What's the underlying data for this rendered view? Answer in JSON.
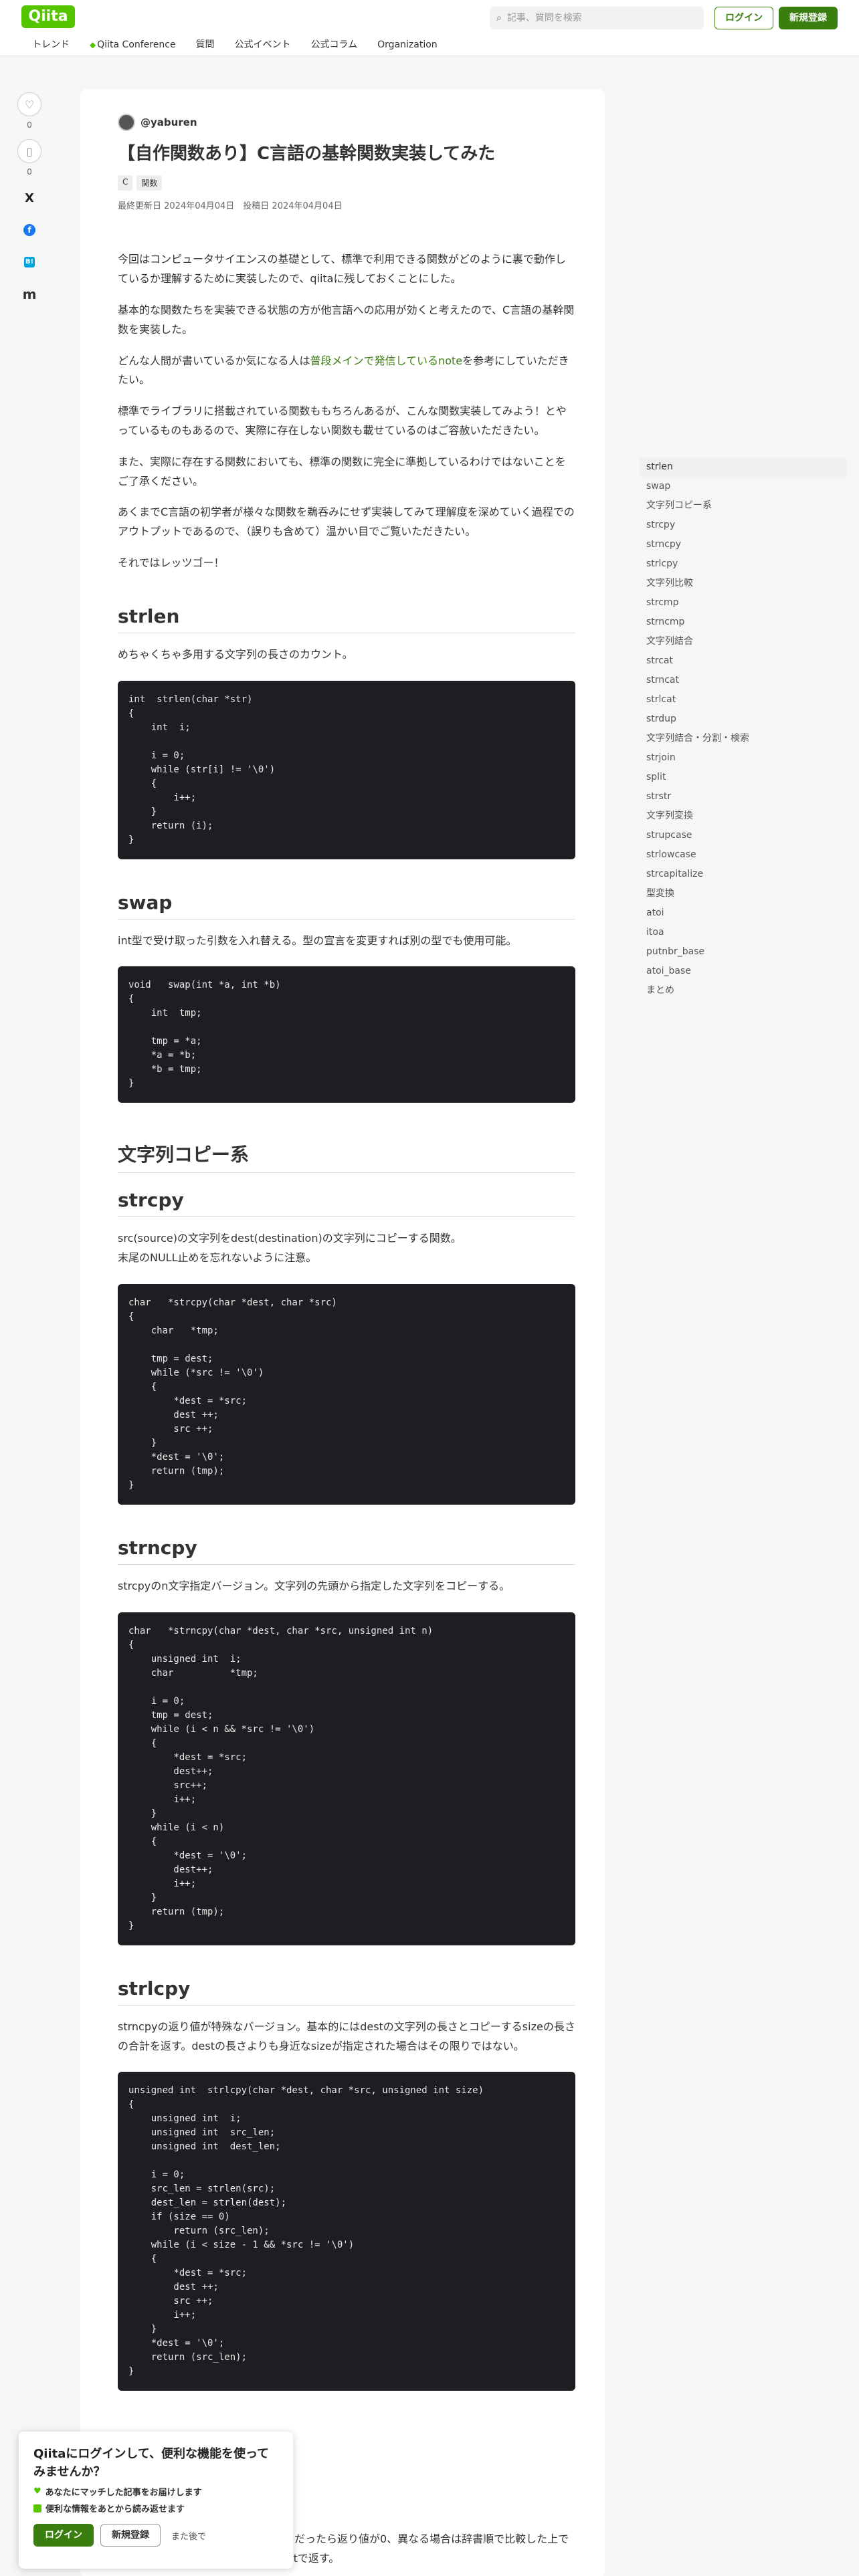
{
  "header": {
    "logo": "Qiita",
    "search_placeholder": "記事、質問を検索",
    "login": "ログイン",
    "signup": "新規登録",
    "nav": [
      "トレンド",
      "Qiita Conference",
      "質問",
      "公式イベント",
      "公式コラム",
      "Organization"
    ]
  },
  "actions": {
    "likes": "0",
    "stocks": "0"
  },
  "article": {
    "author": "@yaburen",
    "title": "【自作関数あり】C言語の基幹関数実装してみた",
    "tags": [
      "C",
      "関数"
    ],
    "dates": "最終更新日 2024年04月04日　投稿日 2024年04月04日",
    "intro": [
      "今回はコンピュータサイエンスの基礎として、標準で利用できる関数がどのように裏で動作しているか理解するために実装したので、qiitaに残しておくことにした。",
      "基本的な関数たちを実装できる状態の方が他言語への応用が効くと考えたので、C言語の基幹関数を実装した。",
      "標準でライブラリに搭載されている関数ももちろんあるが、こんな関数実装してみよう！とやっているものもあるので、実際に存在しない関数も載せているのはご容赦いただきたい。",
      "また、実際に存在する関数においても、標準の関数に完全に準拠しているわけではないことをご了承ください。",
      "あくまでC言語の初学者が様々な関数を鵜呑みにせず実装してみて理解度を深めていく過程でのアウトプットであるので、（誤りも含めて）温かい目でご覧いただきたい。",
      "それではレッツゴー！"
    ],
    "ref_prefix": "どんな人間が書いているか気になる人は",
    "ref_link": "普段メインで発信しているnote",
    "ref_suffix": "を参考にしていただきたい。",
    "strlen_h": "strlen",
    "strlen_p": "めちゃくちゃ多用する文字列の長さのカウント。",
    "strlen_code": "int  strlen(char *str)\n{\n    int  i;\n\n    i = 0;\n    while (str[i] != '\\0')\n    {\n        i++;\n    }\n    return (i);\n}",
    "swap_h": "swap",
    "swap_p": "int型で受け取った引数を入れ替える。型の宣言を変更すれば別の型でも使用可能。",
    "swap_code": "void   swap(int *a, int *b)\n{\n    int  tmp;\n\n    tmp = *a;\n    *a = *b;\n    *b = tmp;\n}",
    "copy_h": "文字列コピー系",
    "strcpy_h": "strcpy",
    "strcpy_p": "src(source)の文字列をdest(destination)の文字列にコピーする関数。\n末尾のNULL止めを忘れないように注意。",
    "strcpy_code": "char   *strcpy(char *dest, char *src)\n{\n    char   *tmp;\n\n    tmp = dest;\n    while (*src != '\\0')\n    {\n        *dest = *src;\n        dest ++;\n        src ++;\n    }\n    *dest = '\\0';\n    return (tmp);\n}",
    "strncpy_h": "strncpy",
    "strncpy_p": "strcpyのn文字指定バージョン。文字列の先頭から指定した文字列をコピーする。",
    "strncpy_code": "char   *strncpy(char *dest, char *src, unsigned int n)\n{\n    unsigned int  i;\n    char          *tmp;\n\n    i = 0;\n    tmp = dest;\n    while (i < n && *src != '\\0')\n    {\n        *dest = *src;\n        dest++;\n        src++;\n        i++;\n    }\n    while (i < n)\n    {\n        *dest = '\\0';\n        dest++;\n        i++;\n    }\n    return (tmp);\n}",
    "strlcpy_h": "strlcpy",
    "strlcpy_p": "strncpyの返り値が特殊なバージョン。基本的にはdestの文字列の長さとコピーするsizeの長さの合計を返す。destの長さよりも身近なsizeが指定された場合はその限りではない。",
    "strlcpy_code": "unsigned int  strlcpy(char *dest, char *src, unsigned int size)\n{\n    unsigned int  i;\n    unsigned int  src_len;\n    unsigned int  dest_len;\n\n    i = 0;\n    src_len = strlen(src);\n    dest_len = strlen(dest);\n    if (size == 0)\n        return (src_len);\n    while (i < size - 1 && *src != '\\0')\n    {\n        *dest = *src;\n        dest ++;\n        src ++;\n        i++;\n    }\n    *dest = '\\0';\n    return (src_len);\n}",
    "strcmp_tail": "る。同じだったら返り値が0、異なる場合は辞書順で比較した上で差分をintで返す。"
  },
  "toc": [
    "strlen",
    "swap",
    "文字列コピー系",
    "strcpy",
    "strncpy",
    "strlcpy",
    "文字列比較",
    "strcmp",
    "strncmp",
    "文字列結合",
    "strcat",
    "strncat",
    "strlcat",
    "strdup",
    "文字列結合・分割・検索",
    "strjoin",
    "split",
    "strstr",
    "文字列変換",
    "strupcase",
    "strlowcase",
    "strcapitalize",
    "型変換",
    "atoi",
    "itoa",
    "putnbr_base",
    "atoi_base",
    "まとめ"
  ],
  "popup": {
    "title": "Qiitaにログインして、便利な機能を使ってみませんか？",
    "feature1": "あなたにマッチした記事をお届けします",
    "feature2": "便利な情報をあとから読み返せます",
    "login": "ログイン",
    "signup": "新規登録",
    "later": "また後で"
  }
}
